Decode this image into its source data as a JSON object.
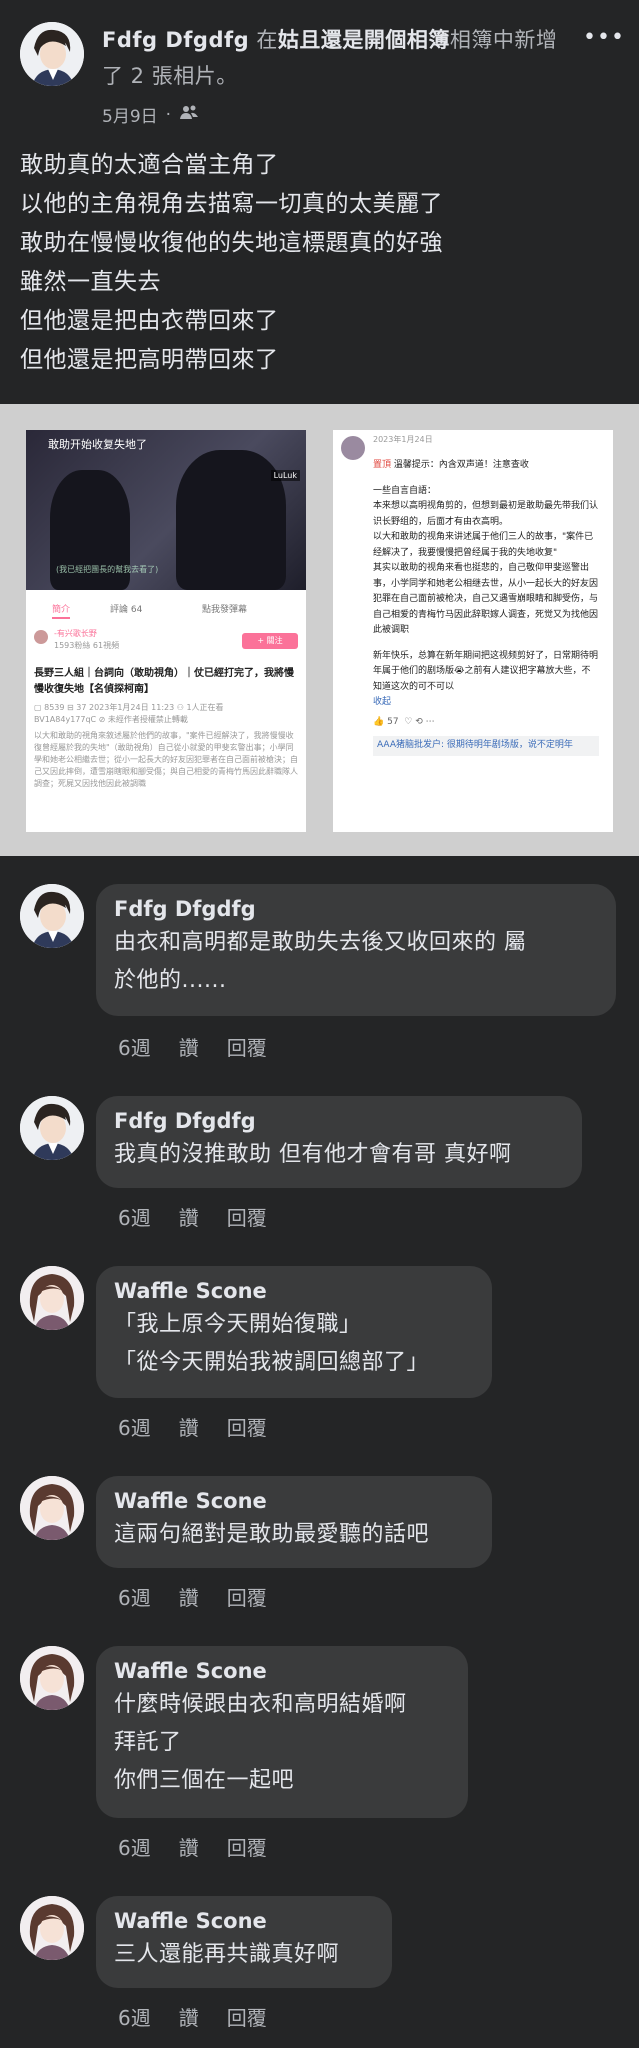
{
  "post": {
    "author": "Fdfg Dfgdfg",
    "action_pre": " 在",
    "album": "姑且還是開個相簿",
    "action_post": "相簿中新增了 2 張相片。",
    "date": "5月9日",
    "more": "•••",
    "body_lines": [
      "敢助真的太適合當主角了",
      "以他的主角視角去描寫一切真的太美麗了",
      "敢助在慢慢收復他的失地這標題真的好強",
      "雖然一直失去",
      "但他還是把由衣帶回來了",
      "但他還是把高明帶回來了"
    ]
  },
  "photo1": {
    "video_title": "敢助开始收复失地了",
    "tag": "LuLuk",
    "subtitle": "(我已經把團長的幫我去看了)",
    "tabs": [
      "簡介",
      "評論 64",
      "點我發彈幕"
    ],
    "uploader": "-有兴歌长野",
    "uploader_meta": "1593粉絲  61視頻",
    "follow": "+ 關注",
    "title": "長野三人組｜台詞向（敢助視角）｜仗已經打完了，我將慢慢收復失地【名偵探柯南】",
    "stats": "▢ 8539  ⊟ 37  2023年1月24日 11:23  ⚇ 1人正在看",
    "id_line": "BV1A84y177qC  ⊘ 未經作者授權禁止轉載",
    "desc": "以大和敢助的視角來敘述屬於他們的故事，\"案件已經解決了，我將慢慢收復曾經屬於我的失地\"（敢助視角）自己從小就愛的甲斐玄警出事；小學同學和她老公相繼去世；從小一起長大的好友因犯罪者在自己面前被槍決；自己又因此摔倒，遭雪崩瞎眼和腳受傷；與自己相愛的青梅竹馬因此辭職隊人調查；死屍又因找他因此被調職"
  },
  "photo2": {
    "date": "2023年1月24日",
    "notice_tag": "置頂",
    "notice": "溫馨提示：內含双声道！注意查收",
    "lines": [
      "一些自言自語：",
      "本来想以高明视角剪的，但想到最初是敢助最先带我们认识长野组的，后面才有由衣高明。",
      "以大和敢助的视角来讲述属于他们三人的故事，\"案件已经解决了，我要慢慢把曾经属于我的失地收复\"",
      "其实以敢助的视角来看也挺悲的，自己敬仰甲斐巡警出事，小学同学和她老公相继去世，从小一起长大的好友因犯罪在自己面前被枪决，自己又遇雪崩眼睛和脚受伤，与自己相爱的青梅竹马因此辞职嫁人调查，死觉又为找他因此被调职",
      "新年快乐，总算在新年期间把这视频剪好了，日常期待明年属于他们的剧场版😭之前有人建议把字幕放大些，不知道这次的可不可以"
    ],
    "collapse": "收起",
    "likes": "57",
    "footer": "AAA猪脑批发户: 很期待明年剧场版，说不定明年"
  },
  "comments": [
    {
      "name": "Fdfg Dfgdfg",
      "lines": [
        "由衣和高明都是敢助失去後又收回來的 屬",
        "於他的......"
      ],
      "time": "6週",
      "like": "讚",
      "reply": "回覆"
    },
    {
      "name": "Fdfg Dfgdfg",
      "lines": [
        "我真的沒推敢助 但有他才會有哥 真好啊"
      ],
      "time": "6週",
      "like": "讚",
      "reply": "回覆"
    },
    {
      "name": "Waffle Scone",
      "lines": [
        "「我上原今天開始復職」",
        "「從今天開始我被調回總部了」"
      ],
      "time": "6週",
      "like": "讚",
      "reply": "回覆"
    },
    {
      "name": "Waffle Scone",
      "lines": [
        "這兩句絕對是敢助最愛聽的話吧"
      ],
      "time": "6週",
      "like": "讚",
      "reply": "回覆"
    },
    {
      "name": "Waffle Scone",
      "lines": [
        "什麼時候跟由衣和高明結婚啊",
        "拜託了",
        "你們三個在一起吧"
      ],
      "time": "6週",
      "like": "讚",
      "reply": "回覆"
    },
    {
      "name": "Waffle Scone",
      "lines": [
        "三人還能再共識真好啊"
      ],
      "time": "6週",
      "like": "讚",
      "reply": "回覆"
    }
  ]
}
